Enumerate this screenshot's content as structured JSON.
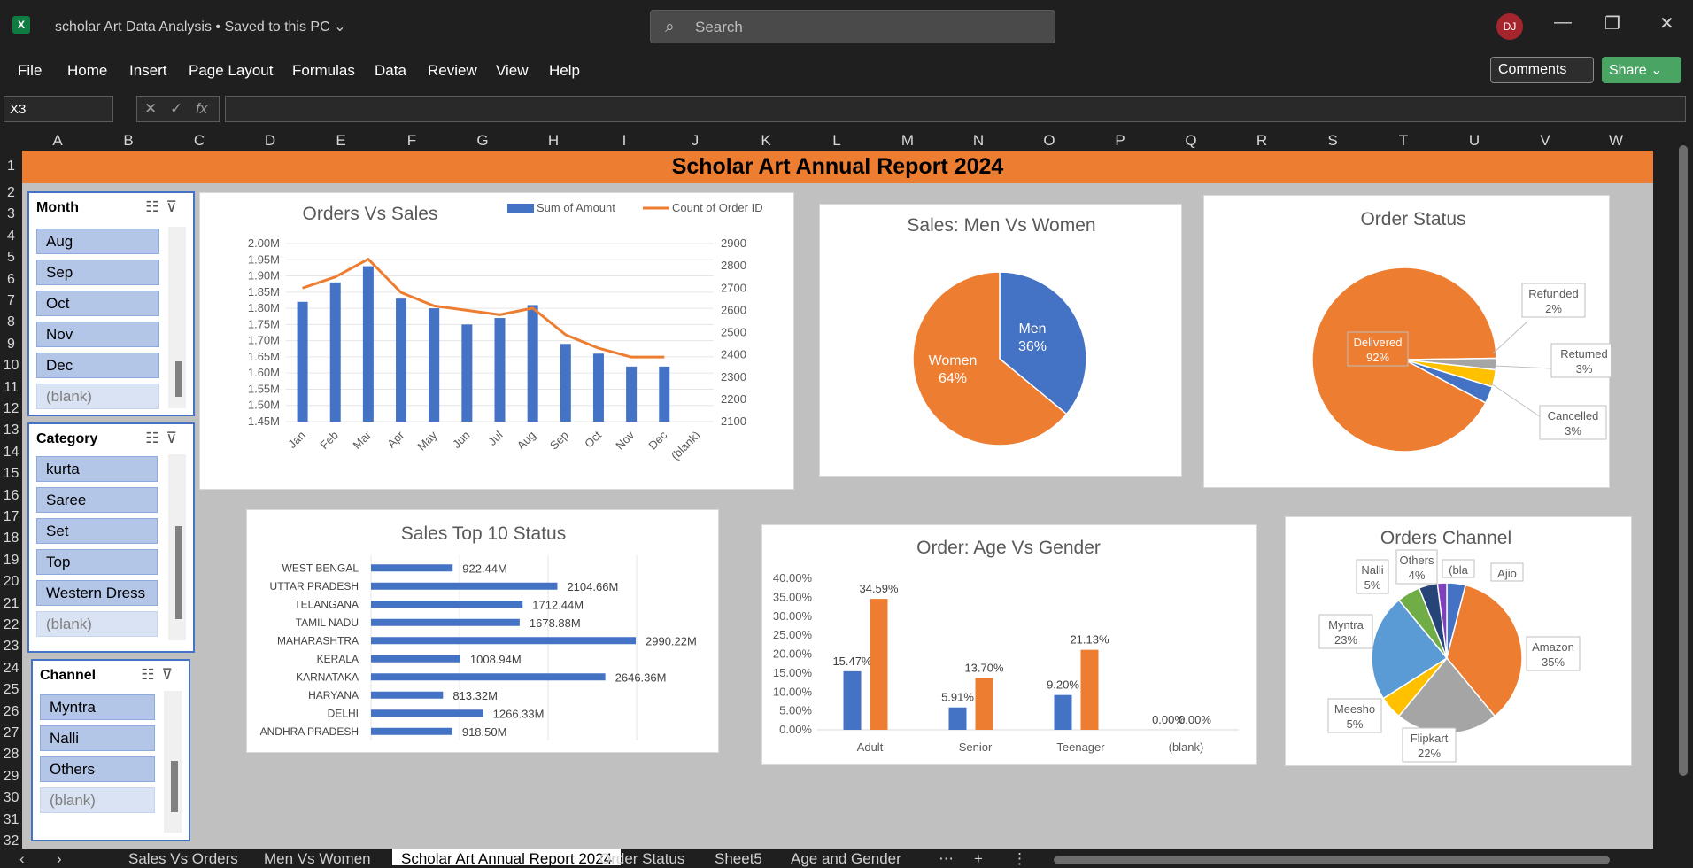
{
  "app": {
    "title": "scholar Art Data Analysis • Saved to this PC ⌄",
    "search_placeholder": "Search",
    "user_initials": "DJ",
    "logo_letter": "X"
  },
  "menu": [
    "File",
    "Home",
    "Insert",
    "Page Layout",
    "Formulas",
    "Data",
    "Review",
    "View",
    "Help"
  ],
  "actions": {
    "comments": "Comments",
    "share": "Share ⌄"
  },
  "formula_bar": {
    "name_box": "X3",
    "formula": ""
  },
  "columns": [
    "A",
    "B",
    "C",
    "D",
    "E",
    "F",
    "G",
    "H",
    "I",
    "J",
    "K",
    "L",
    "M",
    "N",
    "O",
    "P",
    "Q",
    "R",
    "S",
    "T",
    "U",
    "V",
    "W"
  ],
  "rows": [
    "1",
    "2",
    "3",
    "4",
    "5",
    "6",
    "7",
    "8",
    "9",
    "10",
    "11",
    "12",
    "13",
    "14",
    "15",
    "16",
    "17",
    "18",
    "19",
    "20",
    "21",
    "22",
    "23",
    "24",
    "25",
    "26",
    "27",
    "28",
    "29",
    "30",
    "31",
    "32"
  ],
  "banner": "Scholar Art Annual Report 2024",
  "slicers": {
    "month": {
      "title": "Month",
      "items": [
        "Aug",
        "Sep",
        "Oct",
        "Nov",
        "Dec"
      ],
      "blank": "(blank)"
    },
    "category": {
      "title": "Category",
      "items": [
        "kurta",
        "Saree",
        "Set",
        "Top",
        "Western Dress"
      ],
      "blank": "(blank)"
    },
    "channel": {
      "title": "Channel",
      "items": [
        "Myntra",
        "Nalli",
        "Others"
      ],
      "blank": "(blank)"
    }
  },
  "tabs": [
    "Sales Vs Orders",
    "Men Vs Women",
    "Scholar Art Annual Report 2024",
    "Order Status",
    "Sheet5",
    "Age and Gender"
  ],
  "active_tab": "Scholar Art Annual Report 2024",
  "colors": {
    "blue": "#4472c4",
    "orange": "#ed7d31",
    "gray": "#a5a5a5",
    "gold": "#ffc000",
    "lightblue": "#5b9bd5",
    "green": "#70ad47",
    "navy": "#264478"
  },
  "chart_data": [
    {
      "id": "orders_vs_sales",
      "type": "bar",
      "title": "Orders Vs Sales",
      "categories": [
        "Jan",
        "Feb",
        "Mar",
        "Apr",
        "May",
        "Jun",
        "Jul",
        "Aug",
        "Sep",
        "Oct",
        "Nov",
        "Dec",
        "(blank)"
      ],
      "series": [
        {
          "name": "Sum of Amount",
          "type": "bar",
          "axis": "left",
          "values": [
            1.82,
            1.88,
            1.93,
            1.83,
            1.8,
            1.75,
            1.77,
            1.81,
            1.69,
            1.66,
            1.62,
            1.62,
            null
          ]
        },
        {
          "name": "Count of Order ID",
          "type": "line",
          "axis": "right",
          "values": [
            2700,
            2750,
            2830,
            2680,
            2620,
            2600,
            2580,
            2610,
            2490,
            2430,
            2390,
            2390,
            null
          ]
        }
      ],
      "y_left_ticks": [
        "2.00M",
        "1.95M",
        "1.90M",
        "1.85M",
        "1.80M",
        "1.75M",
        "1.70M",
        "1.65M",
        "1.60M",
        "1.55M",
        "1.50M",
        "1.45M"
      ],
      "y_right_ticks": [
        "2900",
        "2800",
        "2700",
        "2600",
        "2500",
        "2400",
        "2300",
        "2200",
        "2100"
      ],
      "ylim_left": [
        1.45,
        2.0
      ],
      "ylim_right": [
        2100,
        2900
      ],
      "legend": "top-right"
    },
    {
      "id": "men_vs_women",
      "type": "pie",
      "title": "Sales: Men Vs Women",
      "slices": [
        {
          "label": "Men",
          "pct_label": "36%",
          "value": 36
        },
        {
          "label": "Women",
          "pct_label": "64%",
          "value": 64
        }
      ]
    },
    {
      "id": "order_status",
      "type": "pie",
      "title": "Order Status",
      "slices": [
        {
          "label": "Delivered",
          "pct_label": "92%",
          "value": 92
        },
        {
          "label": "Refunded",
          "pct_label": "2%",
          "value": 2
        },
        {
          "label": "Returned",
          "pct_label": "3%",
          "value": 3
        },
        {
          "label": "Cancelled",
          "pct_label": "3%",
          "value": 3
        }
      ]
    },
    {
      "id": "sales_top10_states",
      "type": "bar",
      "orientation": "horizontal",
      "title": "Sales Top 10 Status",
      "categories": [
        "WEST BENGAL",
        "UTTAR PRADESH",
        "TELANGANA",
        "TAMIL NADU",
        "MAHARASHTRA",
        "KERALA",
        "KARNATAKA",
        "HARYANA",
        "DELHI",
        "ANDHRA PRADESH"
      ],
      "values": [
        922.44,
        2104.66,
        1712.44,
        1678.88,
        2990.22,
        1008.94,
        2646.36,
        813.32,
        1266.33,
        918.5
      ],
      "value_labels": [
        "922.44M",
        "2104.66M",
        "1712.44M",
        "1678.88M",
        "2990.22M",
        "1008.94M",
        "2646.36M",
        "813.32M",
        "1266.33M",
        "918.50M"
      ],
      "x_ticks": [
        "0M",
        "1000M",
        "2000M",
        "3000M"
      ],
      "xlim": [
        0,
        3000
      ]
    },
    {
      "id": "age_vs_gender",
      "type": "bar",
      "title": "Order: Age Vs Gender",
      "categories": [
        "Adult",
        "Senior",
        "Teenager",
        "(blank)"
      ],
      "series": [
        {
          "values": [
            15.47,
            5.91,
            9.2,
            0.0
          ],
          "labels": [
            "15.47%",
            "5.91%",
            "9.20%",
            "0.00%"
          ]
        },
        {
          "values": [
            34.59,
            13.7,
            21.13,
            0.0
          ],
          "labels": [
            "34.59%",
            "13.70%",
            "21.13%",
            "0.00%"
          ]
        }
      ],
      "y_ticks": [
        "40.00%",
        "35.00%",
        "30.00%",
        "25.00%",
        "20.00%",
        "15.00%",
        "10.00%",
        "5.00%",
        "0.00%"
      ],
      "ylim": [
        0,
        40
      ]
    },
    {
      "id": "orders_channel",
      "type": "pie",
      "title": "Orders Channel",
      "slices": [
        {
          "label": "Ajio",
          "pct_label": "",
          "value": 4
        },
        {
          "label": "Amazon",
          "pct_label": "35%",
          "value": 35
        },
        {
          "label": "Flipkart",
          "pct_label": "22%",
          "value": 22
        },
        {
          "label": "Meesho",
          "pct_label": "5%",
          "value": 5
        },
        {
          "label": "Myntra",
          "pct_label": "23%",
          "value": 23
        },
        {
          "label": "Nalli",
          "pct_label": "5%",
          "value": 5
        },
        {
          "label": "Others",
          "pct_label": "4%",
          "value": 4
        },
        {
          "label": "(bla",
          "pct_label": "",
          "value": 2
        }
      ]
    }
  ]
}
